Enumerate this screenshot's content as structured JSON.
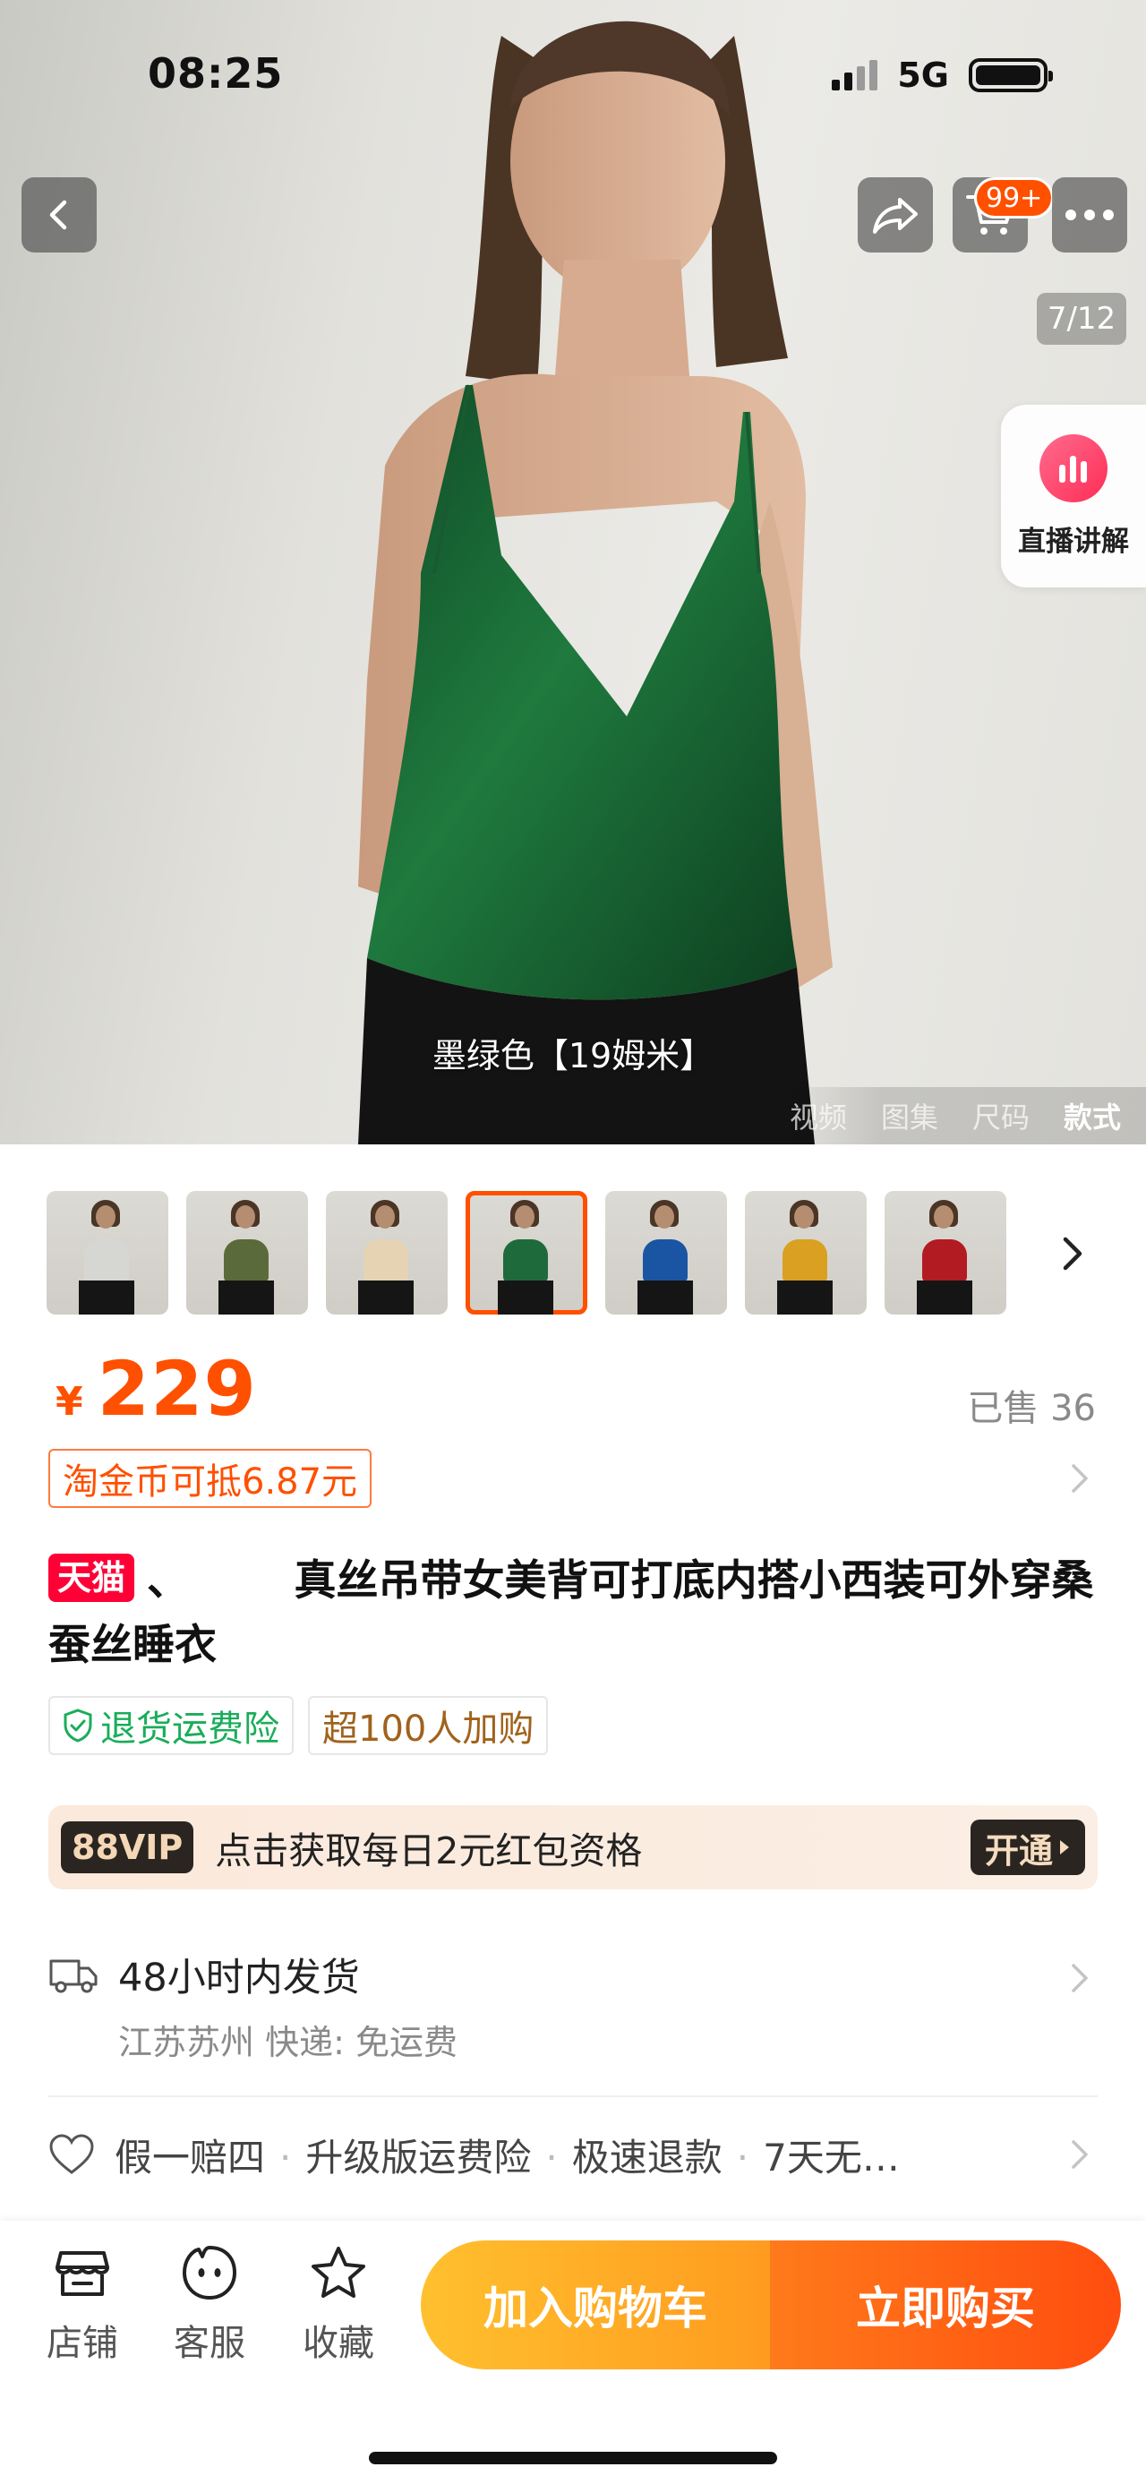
{
  "status_bar": {
    "time": "08:25",
    "network": "5G"
  },
  "hero": {
    "cart_badge": "99+",
    "image_counter": "7/12",
    "live": {
      "label": "直播讲解",
      "icon": "live-stats-icon"
    },
    "variant_caption": "墨绿色【19姆米】",
    "media_tabs": [
      "视频",
      "图集",
      "尺码",
      "款式"
    ],
    "active_media_tab": "款式"
  },
  "thumbnails": {
    "colors": [
      "#d6d6d3",
      "#5b6a3a",
      "#e6d3b3",
      "#1f6a3a",
      "#1a55a3",
      "#d9a021",
      "#b31b22"
    ],
    "selected_index": 3
  },
  "price": {
    "currency": "¥",
    "value": "229",
    "sold": "已售 36"
  },
  "coin_offer": "淘金币可抵6.87元",
  "title": {
    "badge": "天猫",
    "text": "、　　　真丝吊带女美背可打底内搭小西装可外穿桑蚕丝睡衣"
  },
  "tags": [
    {
      "label": "退货运费险",
      "icon": "shield-check-icon",
      "color": "#1aad5a"
    },
    {
      "label": "超100人加购",
      "color": "#a0621c"
    }
  ],
  "vip": {
    "badge": "88VIP",
    "text": "点击获取每日2元红包资格",
    "button": "开通"
  },
  "shipping": {
    "title": "48小时内发货",
    "subtitle": "江苏苏州  快递: 免运费"
  },
  "guarantees": [
    "假一赔四",
    "升级版运费险",
    "极速退款",
    "7天无…"
  ],
  "bottom_nav": [
    {
      "label": "店铺",
      "icon": "shop-icon"
    },
    {
      "label": "客服",
      "icon": "service-face-icon"
    },
    {
      "label": "收藏",
      "icon": "star-icon"
    }
  ],
  "cta": {
    "add_to_cart": "加入购物车",
    "buy_now": "立即购买"
  },
  "colors": {
    "accent": "#ff5000",
    "tmall_red": "#ff0036"
  }
}
